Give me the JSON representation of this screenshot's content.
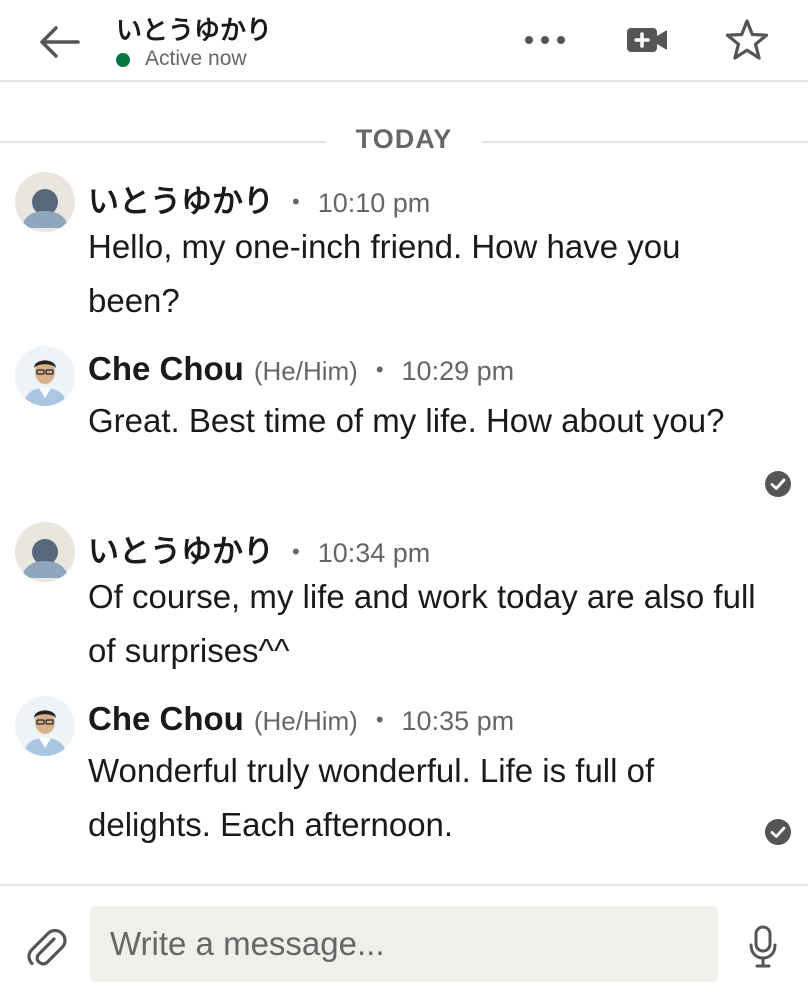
{
  "header": {
    "contact_name": "いとうゆかり",
    "status": "Active now",
    "status_color": "#057642"
  },
  "divider": {
    "label": "TODAY"
  },
  "messages": [
    {
      "sender": "いとうゆかり",
      "pronouns": "",
      "separator": "•",
      "time": "10:10 pm",
      "text": "Hello, my one-inch friend. How have you been?",
      "avatar": "default-avatar-icon",
      "read_receipt": false
    },
    {
      "sender": "Che Chou",
      "pronouns": "(He/Him)",
      "separator": "•",
      "time": "10:29 pm",
      "text": "Great. Best time of my life. How about you?",
      "avatar": "profile-photo",
      "read_receipt": true
    },
    {
      "sender": "いとうゆかり",
      "pronouns": "",
      "separator": "•",
      "time": "10:34 pm",
      "text": "Of course, my life and work today are also full of surprises^^",
      "avatar": "default-avatar-icon",
      "read_receipt": false
    },
    {
      "sender": "Che Chou",
      "pronouns": "(He/Him)",
      "separator": "•",
      "time": "10:35 pm",
      "text": "Wonderful truly wonderful. Life is full of delights. Each afternoon.",
      "avatar": "profile-photo",
      "read_receipt": true
    }
  ],
  "composer": {
    "placeholder": "Write a message...",
    "value": ""
  },
  "icons": {
    "back": "arrow-left-icon",
    "more": "more-horizontal-icon",
    "video": "video-call-icon",
    "star": "star-icon",
    "attach": "paperclip-icon",
    "mic": "microphone-icon",
    "read": "check-circle-icon"
  }
}
